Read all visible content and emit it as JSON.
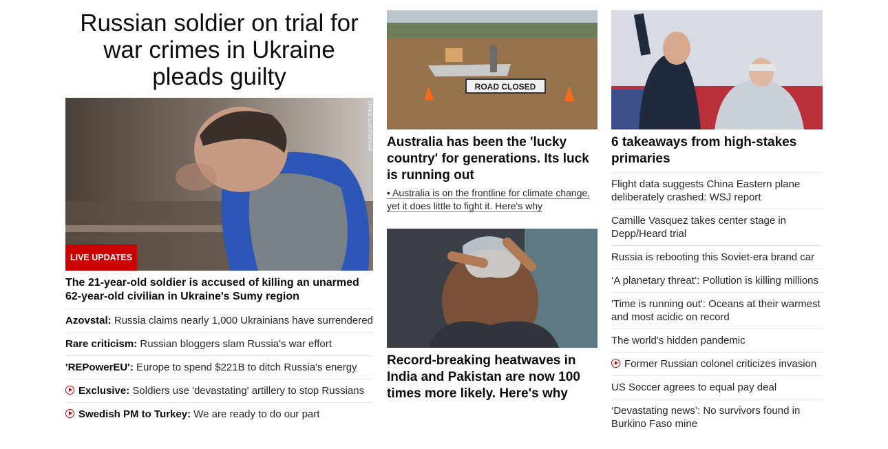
{
  "col1": {
    "headline": "Russian soldier on trial for war crimes in Ukraine pleads guilty",
    "badge": "LIVE UPDATES",
    "photo_credit": "EFREM LUKATSKY/AP",
    "lead": "The 21-year-old soldier is accused of killing an unarmed 62-year-old civilian in Ukraine's Sumy region",
    "items": [
      {
        "bold": "Azovstal:",
        "text": " Russia claims nearly 1,000 Ukrainians have surrendered",
        "video": false
      },
      {
        "bold": "Rare criticism:",
        "text": " Russian bloggers slam Russia's war effort",
        "video": false
      },
      {
        "bold": "'REPowerEU':",
        "text": " Europe to spend $221B to ditch Russia's energy",
        "video": false
      },
      {
        "bold": "Exclusive:",
        "text": " Soldiers use 'devastating' artillery to stop Russians",
        "video": true
      },
      {
        "bold": "Swedish PM to Turkey:",
        "text": " We are ready to do our part",
        "video": true
      }
    ]
  },
  "col2": {
    "story1": {
      "sign_text": "ROAD CLOSED",
      "headline": "Australia has been the 'lucky country' for generations. Its luck is running out",
      "sub": "• Australia is on the frontline for climate change, yet it does little to fight it. Here's why"
    },
    "story2": {
      "headline": "Record-breaking heatwaves in India and Pakistan are now 100 times more likely. Here's why"
    }
  },
  "col3": {
    "headline": "6 takeaways from high-stakes primaries",
    "items": [
      {
        "text": "Flight data suggests China Eastern plane deliberately crashed: WSJ report",
        "video": false
      },
      {
        "text": "Camille Vasquez takes center stage in Depp/Heard trial",
        "video": false
      },
      {
        "text": "Russia is rebooting this Soviet-era brand car",
        "video": false
      },
      {
        "text": "‘A planetary threat’: Pollution is killing millions",
        "video": false
      },
      {
        "text": "'Time is running out': Oceans at their warmest and most acidic on record",
        "video": false
      },
      {
        "text": "The world's hidden pandemic",
        "video": false
      },
      {
        "text": "Former Russian colonel criticizes invasion",
        "video": true
      },
      {
        "text": "US Soccer agrees to equal pay deal",
        "video": false
      },
      {
        "text": "‘Devastating news’: No survivors found in Burkino Faso mine",
        "video": false
      }
    ]
  },
  "colors": {
    "accent": "#cc0000",
    "text": "#0c0c0c",
    "divider": "#e6e6e6"
  }
}
